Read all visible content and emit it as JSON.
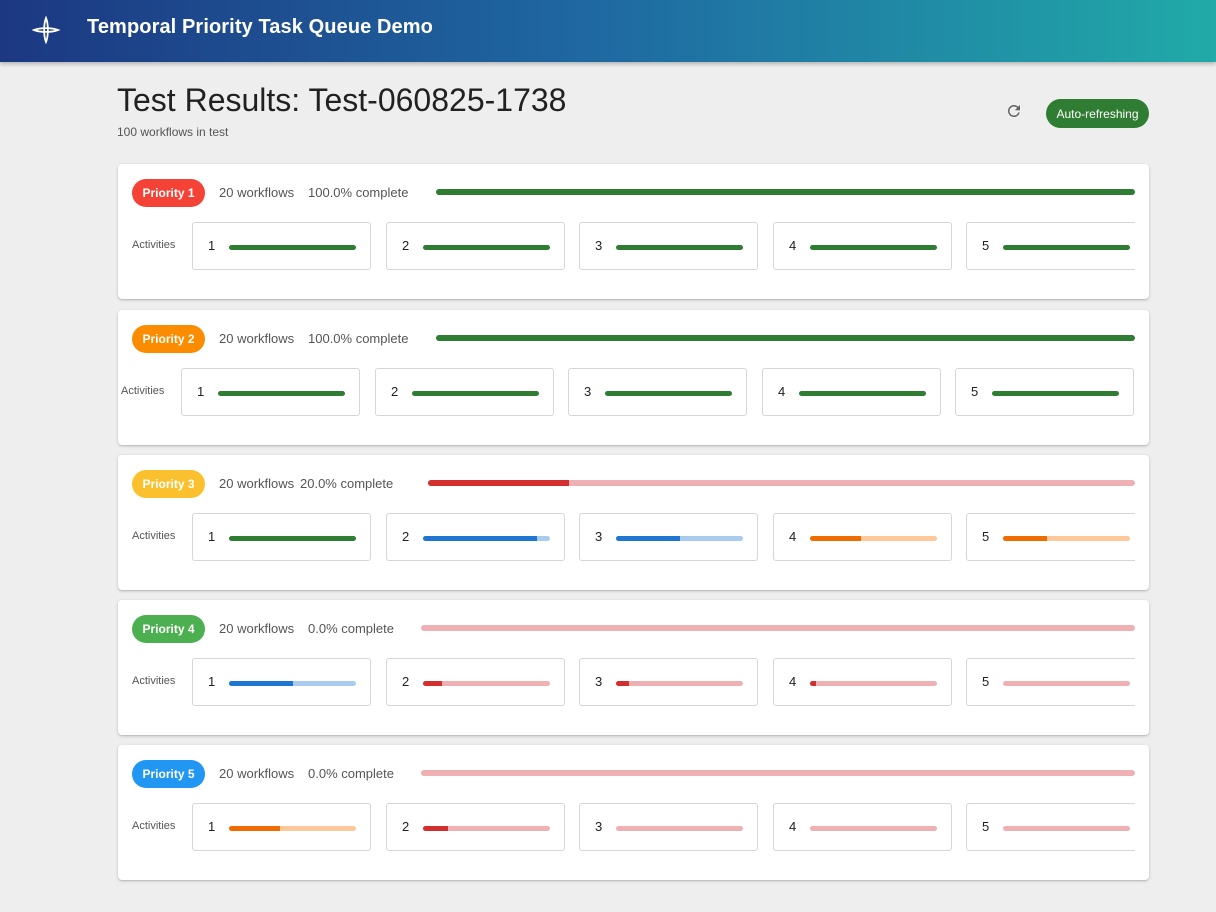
{
  "app": {
    "title": "Temporal Priority Task Queue Demo",
    "logo_icon": "temporal-logo-icon"
  },
  "page": {
    "title": "Test Results: Test-060825-1738",
    "subtitle": "100 workflows in test"
  },
  "controls": {
    "refresh_icon": "refresh-icon",
    "auto_refresh_label": "Auto-refreshing"
  },
  "activities_label": "Activities",
  "colors": {
    "green": "#2e7d32",
    "red": "#d32f2f",
    "red_track": "#eeb0b3",
    "blue": "#1e76d2",
    "blue_track": "#a9cbee",
    "orange": "#ef6c00",
    "orange_track": "#fdc89a"
  },
  "priorities": [
    {
      "label": "Priority 1",
      "chip_color": "#f44336",
      "workflows": "20 workflows",
      "complete": "100.0% complete",
      "progress": 1.0,
      "bar": "green",
      "activities": [
        {
          "num": "1",
          "progress": 1.0,
          "bar": "green"
        },
        {
          "num": "2",
          "progress": 1.0,
          "bar": "green"
        },
        {
          "num": "3",
          "progress": 1.0,
          "bar": "green"
        },
        {
          "num": "4",
          "progress": 1.0,
          "bar": "green"
        },
        {
          "num": "5",
          "progress": 1.0,
          "bar": "green"
        }
      ]
    },
    {
      "label": "Priority 2",
      "chip_color": "#fb8c00",
      "workflows": "20 workflows",
      "complete": "100.0% complete",
      "progress": 1.0,
      "bar": "green",
      "activities": [
        {
          "num": "1",
          "progress": 1.0,
          "bar": "green"
        },
        {
          "num": "2",
          "progress": 1.0,
          "bar": "green"
        },
        {
          "num": "3",
          "progress": 1.0,
          "bar": "green"
        },
        {
          "num": "4",
          "progress": 1.0,
          "bar": "green"
        },
        {
          "num": "5",
          "progress": 1.0,
          "bar": "green"
        }
      ]
    },
    {
      "label": "Priority 3",
      "chip_color": "#fbc02d",
      "workflows": "20 workflows",
      "complete": "20.0% complete",
      "progress": 0.2,
      "bar": "red",
      "activities": [
        {
          "num": "1",
          "progress": 1.0,
          "bar": "green"
        },
        {
          "num": "2",
          "progress": 0.9,
          "bar": "blue"
        },
        {
          "num": "3",
          "progress": 0.5,
          "bar": "blue"
        },
        {
          "num": "4",
          "progress": 0.4,
          "bar": "orange"
        },
        {
          "num": "5",
          "progress": 0.35,
          "bar": "orange"
        }
      ]
    },
    {
      "label": "Priority 4",
      "chip_color": "#4caf50",
      "workflows": "20 workflows",
      "complete": "0.0% complete",
      "progress": 0.0,
      "bar": "red",
      "activities": [
        {
          "num": "1",
          "progress": 0.5,
          "bar": "blue"
        },
        {
          "num": "2",
          "progress": 0.15,
          "bar": "red"
        },
        {
          "num": "3",
          "progress": 0.1,
          "bar": "red"
        },
        {
          "num": "4",
          "progress": 0.05,
          "bar": "red"
        },
        {
          "num": "5",
          "progress": 0.0,
          "bar": "red"
        }
      ]
    },
    {
      "label": "Priority 5",
      "chip_color": "#2196f3",
      "workflows": "20 workflows",
      "complete": "0.0% complete",
      "progress": 0.0,
      "bar": "red",
      "activities": [
        {
          "num": "1",
          "progress": 0.4,
          "bar": "orange"
        },
        {
          "num": "2",
          "progress": 0.2,
          "bar": "red"
        },
        {
          "num": "3",
          "progress": 0.0,
          "bar": "red"
        },
        {
          "num": "4",
          "progress": 0.0,
          "bar": "red"
        },
        {
          "num": "5",
          "progress": 0.0,
          "bar": "red"
        }
      ]
    }
  ]
}
